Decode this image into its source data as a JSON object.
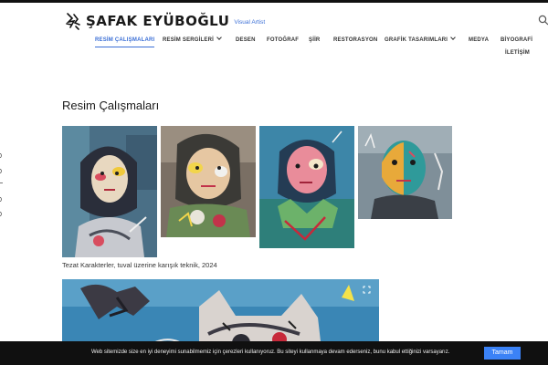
{
  "header": {
    "logo_name": "ŞAFAK EYÜBOĞLU",
    "logo_tagline": "Visual Artist",
    "search_icon": "search-icon"
  },
  "nav": {
    "items": [
      {
        "label": "RESİM ÇALIŞMALARI",
        "active": true,
        "dropdown": false
      },
      {
        "label": "RESİM SERGİLERİ",
        "active": false,
        "dropdown": true
      },
      {
        "label": "DESEN",
        "active": false,
        "dropdown": false
      },
      {
        "label": "FOTOĞRAF",
        "active": false,
        "dropdown": false
      },
      {
        "label": "ŞİİR",
        "active": false,
        "dropdown": false
      },
      {
        "label": "RESTORASYON",
        "active": false,
        "dropdown": false
      },
      {
        "label": "GRAFİK TASARIMLARI",
        "active": false,
        "dropdown": true
      },
      {
        "label": "MEDYA",
        "active": false,
        "dropdown": false
      },
      {
        "label": "BİYOGRAFİ",
        "active": false,
        "dropdown": false
      },
      {
        "label": "İLETİŞİM",
        "active": false,
        "dropdown": false
      }
    ],
    "accent_color": "#3b6fd6"
  },
  "side": {
    "marks": [
      "0",
      "0",
      "0",
      "0"
    ]
  },
  "main": {
    "title": "Resim Çalışmaları",
    "gallery_caption": "Tezat Karakterler, tuval üzerine karışık teknik, 2024"
  },
  "cookie": {
    "message": "Web sitemizde size en iyi deneyimi sunabilmemiz için çerezleri kullanıyoruz. Bu siteyi kullanmaya devam ederseniz, bunu kabul ettiğinizi varsayarız.",
    "button_label": "Tamam",
    "button_color": "#3b82f6"
  }
}
